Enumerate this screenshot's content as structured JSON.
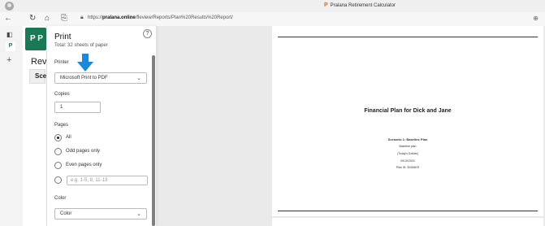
{
  "window": {
    "title": "Pralana Retirement Calculator",
    "logo_letter": "P"
  },
  "nav": {
    "url_prefix": "https://",
    "url_domain": "pralana.online",
    "url_path": "/fleview/Reports/Plan%20Results%20Report/"
  },
  "background_page": {
    "logo_text": "P P",
    "heading": "Rev",
    "tab": "Sce"
  },
  "print_dialog": {
    "title": "Print",
    "subtitle": "Total: 32 sheets of paper",
    "printer_label": "Printer",
    "printer_value": "Microsoft Print to PDF",
    "copies_label": "Copies",
    "copies_value": "1",
    "pages_label": "Pages",
    "pages_options": [
      "All",
      "Odd pages only",
      "Even pages only"
    ],
    "range_placeholder": "e.g. 1-5, 8, 11-13",
    "color_label": "Color",
    "color_value": "Color",
    "help": "?"
  },
  "preview": {
    "doc_title": "Financial Plan for Dick and Jane",
    "scenario": "Scenario 1: Baseline Plan",
    "lines": [
      "Baseline plan",
      "(Today's Dollars)",
      "09/10/2024",
      "Plan ID: 3045AKR"
    ]
  }
}
